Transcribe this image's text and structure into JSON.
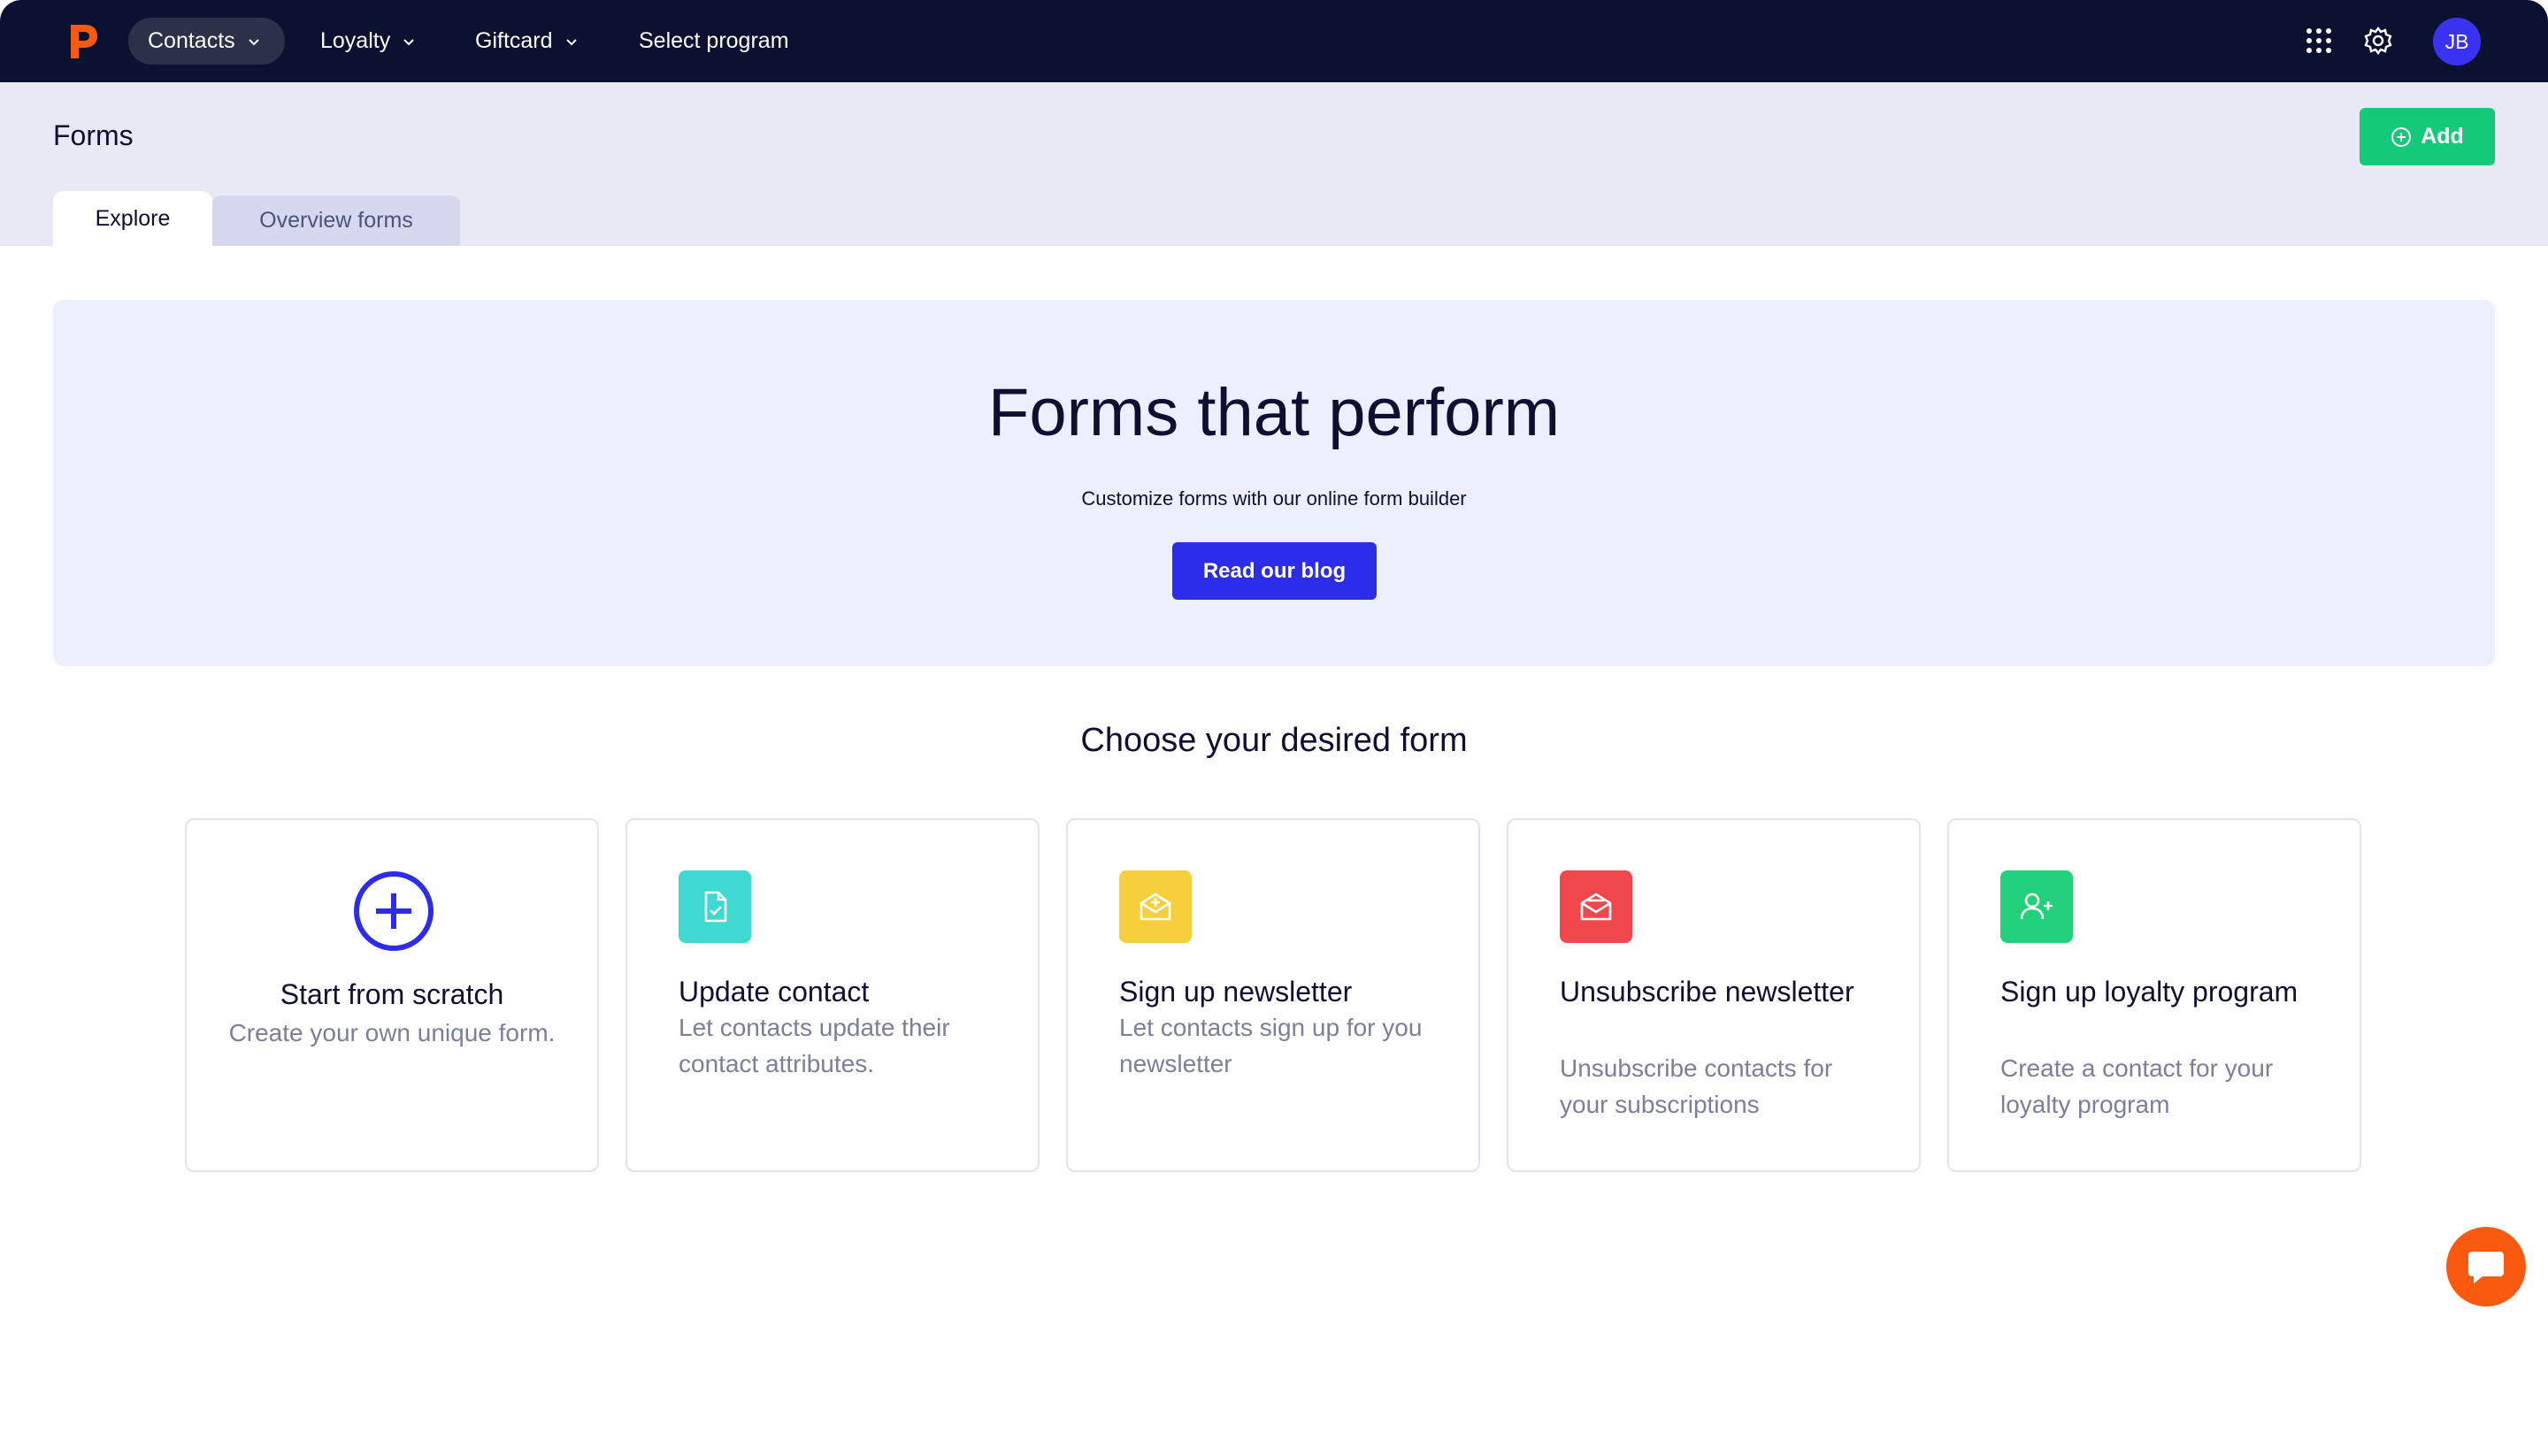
{
  "nav": {
    "logo_icon": "brand-p-logo",
    "items": [
      {
        "label": "Contacts",
        "has_dropdown": true,
        "active": true
      },
      {
        "label": "Loyalty",
        "has_dropdown": true,
        "active": false
      },
      {
        "label": "Giftcard",
        "has_dropdown": true,
        "active": false
      },
      {
        "label": "Select program",
        "has_dropdown": false,
        "active": false
      }
    ],
    "apps_icon": "grid-icon",
    "settings_icon": "gear-icon",
    "avatar_initials": "JB"
  },
  "header": {
    "title": "Forms",
    "add_label": "Add",
    "tabs": [
      {
        "label": "Explore",
        "active": true
      },
      {
        "label": "Overview forms",
        "active": false
      }
    ]
  },
  "hero": {
    "title": "Forms that perform",
    "subtitle": "Customize forms with our online form builder",
    "button_label": "Read our blog"
  },
  "section": {
    "title": "Choose your desired form"
  },
  "cards": [
    {
      "title": "Start from scratch",
      "description": "Create your own unique form.",
      "icon": "plus-circle-icon",
      "color": "#2c2de8"
    },
    {
      "title": "Update contact",
      "description": "Let contacts update their contact attributes.",
      "icon": "document-check-icon",
      "color": "#3ed9d0"
    },
    {
      "title": "Sign up newsletter",
      "description": "Let contacts sign up for you newsletter",
      "icon": "envelope-plus-icon",
      "color": "#f7cf3c"
    },
    {
      "title": "Unsubscribe newsletter",
      "description": "Unsubscribe contacts for your subscriptions",
      "icon": "envelope-open-icon",
      "color": "#f0474c"
    },
    {
      "title": "Sign up loyalty program",
      "description": "Create a contact for your loyalty program",
      "icon": "user-plus-icon",
      "color": "#22d17a"
    }
  ],
  "colors": {
    "nav_bg": "#0a1131",
    "header_bg": "#e9e9f5",
    "hero_bg": "#eceffd",
    "primary": "#2c2de8",
    "success": "#14c97a",
    "chat": "#fa5a0f"
  },
  "chat_icon": "chat-bubble-icon"
}
